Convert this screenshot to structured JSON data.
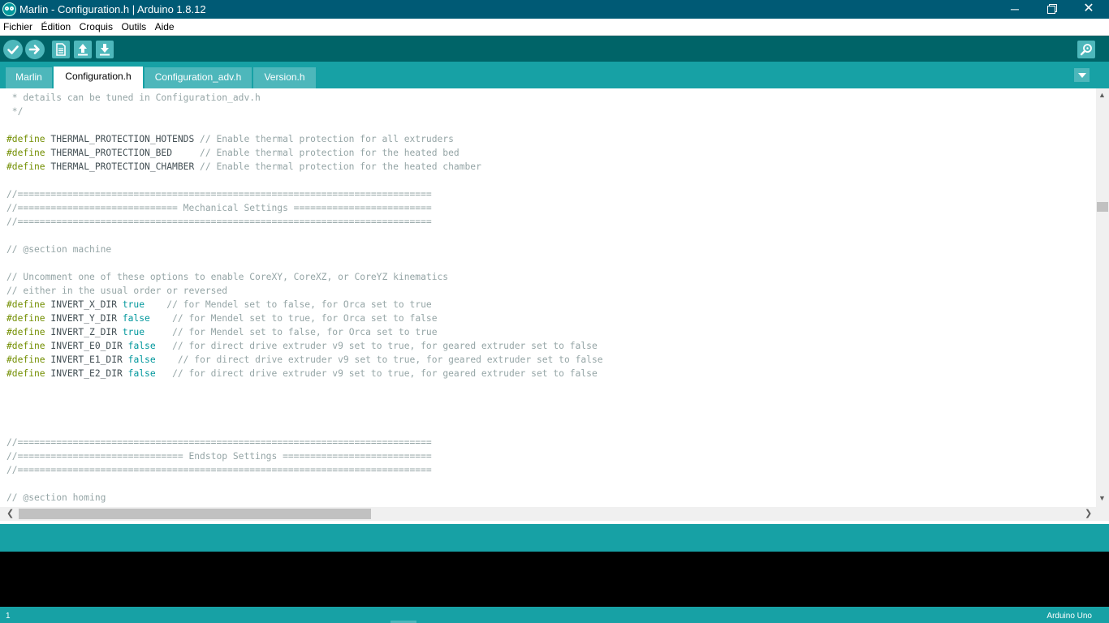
{
  "window": {
    "title": "Marlin - Configuration.h | Arduino 1.8.12",
    "minimize": "─",
    "close": "✕"
  },
  "menu": [
    "Fichier",
    "Édition",
    "Croquis",
    "Outils",
    "Aide"
  ],
  "toolbar": {
    "verify_icon": "check-icon",
    "upload_icon": "arrow-right-icon",
    "new_icon": "new-file-icon",
    "open_icon": "arrow-up-icon",
    "save_icon": "arrow-down-icon",
    "serial_monitor_icon": "magnifier-icon"
  },
  "tabs": [
    {
      "label": "Marlin",
      "active": false
    },
    {
      "label": "Configuration.h",
      "active": true
    },
    {
      "label": "Configuration_adv.h",
      "active": false
    },
    {
      "label": "Version.h",
      "active": false
    }
  ],
  "code_lines": [
    " * details can be tuned in Configuration_adv.h",
    " */",
    "",
    "#define THERMAL_PROTECTION_HOTENDS // Enable thermal protection for all extruders",
    "#define THERMAL_PROTECTION_BED     // Enable thermal protection for the heated bed",
    "#define THERMAL_PROTECTION_CHAMBER // Enable thermal protection for the heated chamber",
    "",
    "//===========================================================================",
    "//============================= Mechanical Settings =========================",
    "//===========================================================================",
    "",
    "// @section machine",
    "",
    "// Uncomment one of these options to enable CoreXY, CoreXZ, or CoreYZ kinematics",
    "// either in the usual order or reversed",
    "#define INVERT_X_DIR true    // for Mendel set to false, for Orca set to true",
    "#define INVERT_Y_DIR false    // for Mendel set to true, for Orca set to false",
    "#define INVERT_Z_DIR true     // for Mendel set to false, for Orca set to true",
    "#define INVERT_E0_DIR false   // for direct drive extruder v9 set to true, for geared extruder set to false",
    "#define INVERT_E1_DIR false    // for direct drive extruder v9 set to true, for geared extruder set to false",
    "#define INVERT_E2_DIR false   // for direct drive extruder v9 set to true, for geared extruder set to false",
    "",
    "",
    "",
    "",
    "//===========================================================================",
    "//============================== Endstop Settings ===========================",
    "//===========================================================================",
    "",
    "// @section homing"
  ],
  "colors": {
    "titlebar": "#005a75",
    "toolbar": "#006468",
    "tabs_bar": "#17a1a5",
    "button": "#4db7bb",
    "keyword": "#728e00",
    "comment": "#95a5a6",
    "boolean": "#00979c",
    "console": "#000000"
  },
  "status": {
    "line": "1",
    "board": "Arduino Uno"
  }
}
